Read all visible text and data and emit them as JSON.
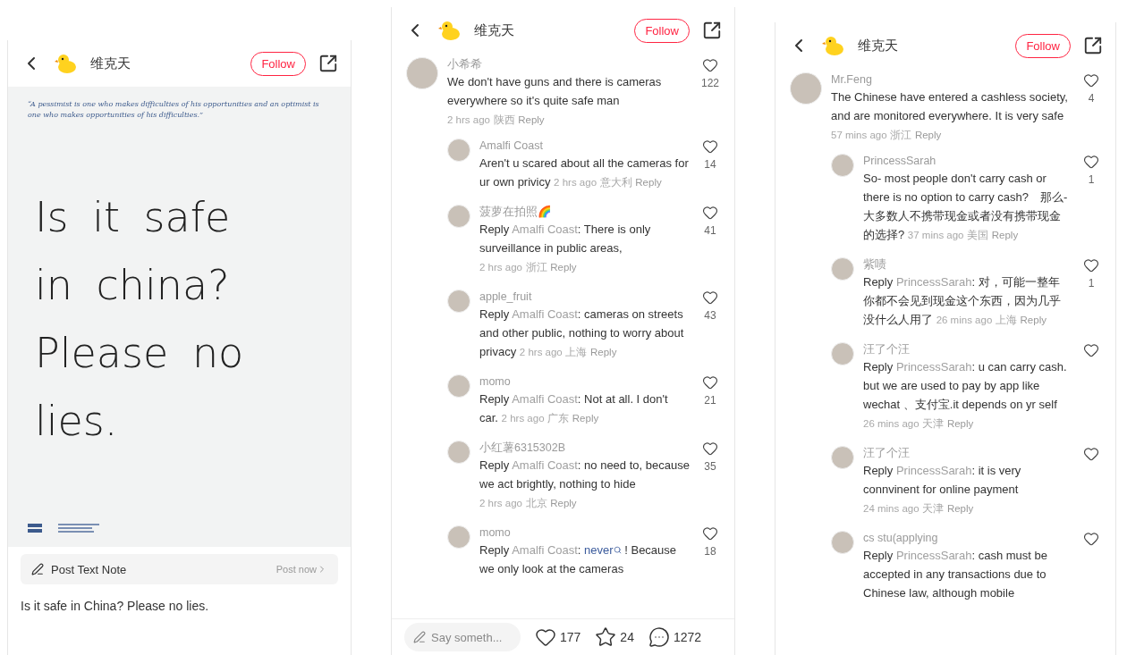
{
  "panels": [
    {
      "kind": "note",
      "header": {
        "author": "维克天",
        "follow": "Follow"
      },
      "note": {
        "quote": "“A pessimist is one who makes difficulties of his opportunities and an optimist is one who makes opportunities of his difficulties.”",
        "handwriting": "Is it safe in china? Please no lies."
      },
      "post_bar": {
        "label": "Post Text Note",
        "action": "Post now"
      },
      "caption": "Is it safe in China? Please no lies."
    },
    {
      "kind": "comments",
      "header": {
        "author": "维克天",
        "follow": "Follow"
      },
      "comments": [
        {
          "name": "小希希",
          "parts": [
            {
              "kind": "plain",
              "text": "We don't have guns and there is cameras everywhere so it's quite safe man"
            }
          ],
          "time": "2 hrs ago",
          "location": "陕西",
          "reply": "Reply",
          "likes": "122",
          "children": [
            {
              "name": "Amalfi Coast",
              "parts": [
                {
                  "kind": "plain",
                  "text": "Aren't u scared about all the cameras for ur own privicy"
                }
              ],
              "time": "2 hrs ago",
              "location": "意大利",
              "reply": "Reply",
              "likes": "14"
            },
            {
              "name": "菠萝在拍照🌈",
              "reply_prefix": "Reply",
              "reply_to": "Amalfi Coast",
              "parts": [
                {
                  "kind": "plain",
                  "text": ": There is only surveillance in public areas,"
                }
              ],
              "time": "2 hrs ago",
              "location": "浙江",
              "reply": "Reply",
              "likes": "41"
            },
            {
              "name": "apple_fruit",
              "reply_prefix": "Reply",
              "reply_to": "Amalfi Coast",
              "parts": [
                {
                  "kind": "plain",
                  "text": ": cameras on streets and other public, nothing to worry about privacy"
                }
              ],
              "time": "2 hrs ago",
              "location": "上海",
              "reply": "Reply",
              "likes": "43"
            },
            {
              "name": "momo",
              "reply_prefix": "Reply",
              "reply_to": "Amalfi Coast",
              "parts": [
                {
                  "kind": "plain",
                  "text": ": Not at all. I don't car."
                }
              ],
              "time": "2 hrs ago",
              "location": "广东",
              "reply": "Reply",
              "likes": "21"
            },
            {
              "name": "小红薯6315302B",
              "reply_prefix": "Reply",
              "reply_to": "Amalfi Coast",
              "parts": [
                {
                  "kind": "plain",
                  "text": ": no need to, because we act brightly, nothing to hide"
                }
              ],
              "time": "2 hrs ago",
              "location": "北京",
              "reply": "Reply",
              "likes": "35"
            },
            {
              "name": "momo",
              "reply_prefix": "Reply",
              "reply_to": "Amalfi Coast",
              "parts": [
                {
                  "kind": "plain",
                  "text": ": "
                },
                {
                  "kind": "link",
                  "text": "never"
                },
                {
                  "kind": "plain",
                  "text": " ! Because we only look at the cameras"
                }
              ],
              "likes": "18"
            }
          ]
        }
      ],
      "bottom_bar": {
        "placeholder": "Say someth...",
        "likes": "177",
        "stars": "24",
        "comments": "1272"
      }
    },
    {
      "kind": "comments",
      "header": {
        "author": "维克天",
        "follow": "Follow"
      },
      "comments": [
        {
          "name": "Mr.Feng",
          "parts": [
            {
              "kind": "plain",
              "text": "The Chinese have entered a cashless society, and are monitored everywhere. It is very safe"
            }
          ],
          "time": "57 mins ago",
          "location": "浙江",
          "reply": "Reply",
          "likes": "4",
          "children": [
            {
              "name": "PrincessSarah",
              "parts": [
                {
                  "kind": "plain",
                  "text": "So- most people don't carry cash or there is no option to carry cash?　那么-大多数人不携带现金或者没有携带现金的选择?"
                }
              ],
              "time": "37 mins ago",
              "location": "美国",
              "reply": "Reply",
              "likes": "1"
            },
            {
              "name": "紫啧",
              "reply_prefix": "Reply",
              "reply_to": "PrincessSarah",
              "parts": [
                {
                  "kind": "plain",
                  "text": ": 对，可能一整年你都不会见到现金这个东西，因为几乎没什么人用了"
                }
              ],
              "time": "26 mins ago",
              "location": "上海",
              "reply": "Reply",
              "likes": "1"
            },
            {
              "name": "汪了个汪",
              "reply_prefix": "Reply",
              "reply_to": "PrincessSarah",
              "parts": [
                {
                  "kind": "plain",
                  "text": ": u can carry cash. but we are used to pay by app like wechat 、支付宝.it depends on yr self"
                }
              ],
              "time": "26 mins ago",
              "location": "天津",
              "reply": "Reply"
            },
            {
              "name": "汪了个汪",
              "reply_prefix": "Reply",
              "reply_to": "PrincessSarah",
              "parts": [
                {
                  "kind": "plain",
                  "text": ": it is very connvinent for online payment"
                }
              ],
              "time": "24 mins ago",
              "location": "天津",
              "reply": "Reply"
            },
            {
              "name": "cs stu(applying",
              "reply_prefix": "Reply",
              "reply_to": "PrincessSarah",
              "parts": [
                {
                  "kind": "plain",
                  "text": ": cash must be accepted in any transactions due to Chinese law, although mobile"
                }
              ]
            }
          ]
        }
      ]
    }
  ]
}
